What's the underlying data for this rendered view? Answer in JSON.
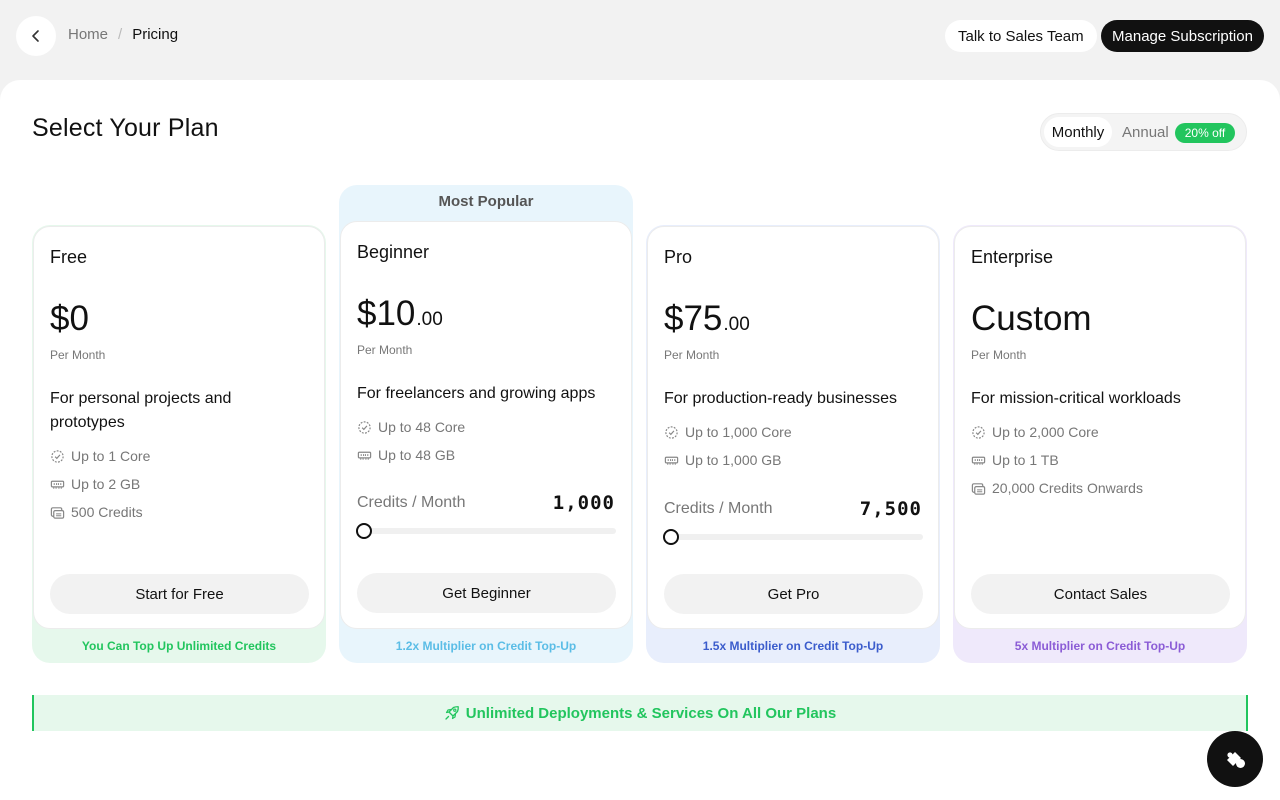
{
  "breadcrumb": {
    "home": "Home",
    "separator": "/",
    "current": "Pricing"
  },
  "header": {
    "sales_button": "Talk to Sales Team",
    "manage_button": "Manage Subscription"
  },
  "page": {
    "title": "Select Your Plan"
  },
  "billing": {
    "monthly": "Monthly",
    "annual": "Annual",
    "discount": "20% off",
    "selected": "Monthly"
  },
  "plans": [
    {
      "name": "Free",
      "price": "$0",
      "cents": "",
      "period": "Per Month",
      "description": "For personal projects and prototypes",
      "features": [
        "Up to 1 Core",
        "Up to 2 GB",
        "500 Credits"
      ],
      "cta": "Start for Free",
      "footer": "You Can Top Up Unlimited Credits"
    },
    {
      "name": "Beginner",
      "badge": "Most Popular",
      "price": "$10",
      "cents": ".00",
      "period": "Per Month",
      "description": "For freelancers and growing apps",
      "features": [
        "Up to 48 Core",
        "Up to 48 GB"
      ],
      "credits_label": "Credits / Month",
      "credits_value": "1,000",
      "cta": "Get Beginner",
      "footer": "1.2x Multiplier on Credit Top-Up"
    },
    {
      "name": "Pro",
      "price": "$75",
      "cents": ".00",
      "period": "Per Month",
      "description": "For production-ready businesses",
      "features": [
        "Up to 1,000 Core",
        "Up to 1,000 GB"
      ],
      "credits_label": "Credits / Month",
      "credits_value": "7,500",
      "cta": "Get Pro",
      "footer": "1.5x Multiplier on Credit Top-Up"
    },
    {
      "name": "Enterprise",
      "price": "Custom",
      "cents": "",
      "period": "Per Month",
      "description": "For mission-critical workloads",
      "features": [
        "Up to 2,000 Core",
        "Up to 1 TB",
        "20,000 Credits Onwards"
      ],
      "cta": "Contact Sales",
      "footer": "5x Multiplier on Credit Top-Up"
    }
  ],
  "banner": {
    "text": "Unlimited Deployments & Services On All Our Plans"
  },
  "icons": {
    "back": "chevron-left-icon",
    "cpu": "cpu-icon",
    "memory": "memory-icon",
    "credits": "coins-icon",
    "rocket": "rocket-icon",
    "chat": "chat-icon"
  },
  "colors": {
    "free_footer_bg": "#e6f8ec",
    "free_footer_text": "#22c55e",
    "beginner_bg": "#e8f5fc",
    "beginner_footer_text": "#5bbde6",
    "pro_footer_bg": "#e8eefc",
    "pro_footer_text": "#3b5ccc",
    "enterprise_footer_bg": "#efe9fb",
    "enterprise_footer_text": "#8b5cd6",
    "accent_green": "#22c55e"
  }
}
